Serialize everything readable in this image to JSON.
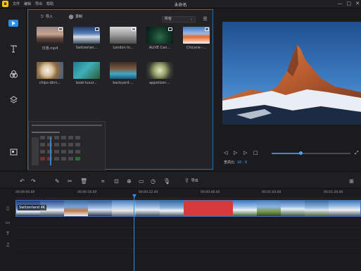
{
  "app": {
    "title": "未命名",
    "menu": [
      "文件",
      "编辑",
      "导出",
      "帮助"
    ],
    "window_controls": [
      "—",
      "□",
      "✕"
    ],
    "colors": {
      "accent": "#2f8fe6",
      "logo": "#f5c400"
    }
  },
  "sidebar": {
    "items": [
      {
        "name": "media",
        "icon": "play-icon",
        "active": true
      },
      {
        "name": "text",
        "icon": "text-icon"
      },
      {
        "name": "filters",
        "icon": "filter-icon"
      },
      {
        "name": "overlays",
        "icon": "layers-icon"
      },
      {
        "name": "elements",
        "icon": "elements-icon"
      }
    ]
  },
  "media": {
    "import_label": "导入",
    "record_label": "录制",
    "filter_value": "所有",
    "items": [
      {
        "label": "日落.mp4"
      },
      {
        "label": "Switzerlan..."
      },
      {
        "label": "London In..."
      },
      {
        "label": "ALIVE  Can..."
      },
      {
        "label": "Chicane -..."
      },
      {
        "label": "chips-dinn..."
      },
      {
        "label": "boat-luxur..."
      },
      {
        "label": "backyard-..."
      },
      {
        "label": "appetizer-..."
      }
    ]
  },
  "preview": {
    "ratio_label": "宽高比:",
    "ratio_value": "16 : 9",
    "progress": 0.37
  },
  "toolbar": {
    "export_label": "导出"
  },
  "timeline": {
    "ticks": [
      "00:00:00.00",
      "00:00:16.00",
      "00:00:32.00",
      "00:00:48.00",
      "00:01:04.00",
      "00:01:20.00"
    ],
    "clip_label": "Switzerland 4K"
  }
}
